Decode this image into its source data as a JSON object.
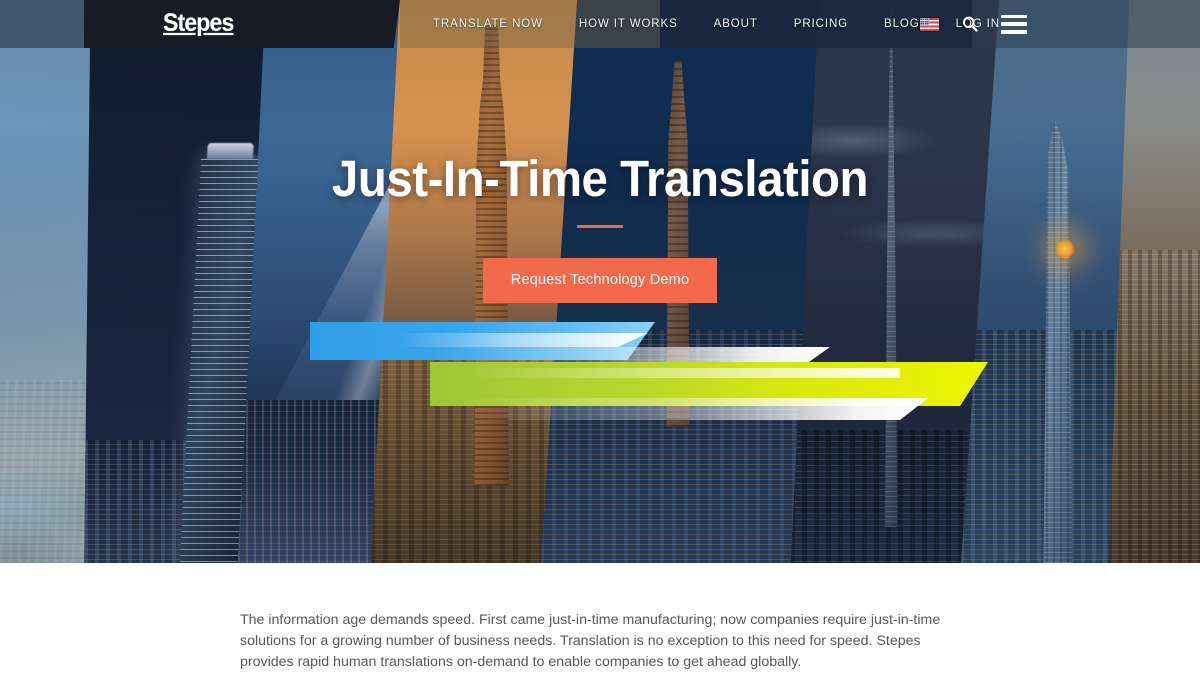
{
  "header": {
    "logo": "Stepes",
    "nav": [
      {
        "label": "TRANSLATE NOW",
        "name": "nav-translate-now"
      },
      {
        "label": "HOW IT WORKS",
        "name": "nav-how-it-works"
      },
      {
        "label": "ABOUT",
        "name": "nav-about"
      },
      {
        "label": "PRICING",
        "name": "nav-pricing"
      },
      {
        "label": "BLOG",
        "name": "nav-blog"
      },
      {
        "label": "LOG IN",
        "name": "nav-log-in"
      }
    ],
    "icons": {
      "language_flag": "us-flag-icon",
      "search": "search-icon",
      "menu": "hamburger-menu-icon"
    }
  },
  "hero": {
    "title": "Just-In-Time Translation",
    "cta_label": "Request Technology Demo",
    "accent_color": "#f4694c",
    "divider": "title-rule",
    "streak_colors": {
      "blue": "#3aa6ec",
      "green": "#d8e80f",
      "white": "#ffffff"
    },
    "city_panels": [
      "hong-kong-skyline",
      "hong-kong-tower-night",
      "mount-fuji-tokyo",
      "new-york-empire-state",
      "new-york-clock-tower",
      "dubai-burj-khalifa",
      "shanghai-tower-sunset",
      "aerial-city-warm"
    ]
  },
  "main": {
    "intro_paragraph": "The information age demands speed. First came just-in-time manufacturing; now companies require just-in-time solutions for a growing number of business needs. Translation is no exception to this need for speed. Stepes provides rapid human translations on-demand to enable companies to get ahead globally."
  }
}
